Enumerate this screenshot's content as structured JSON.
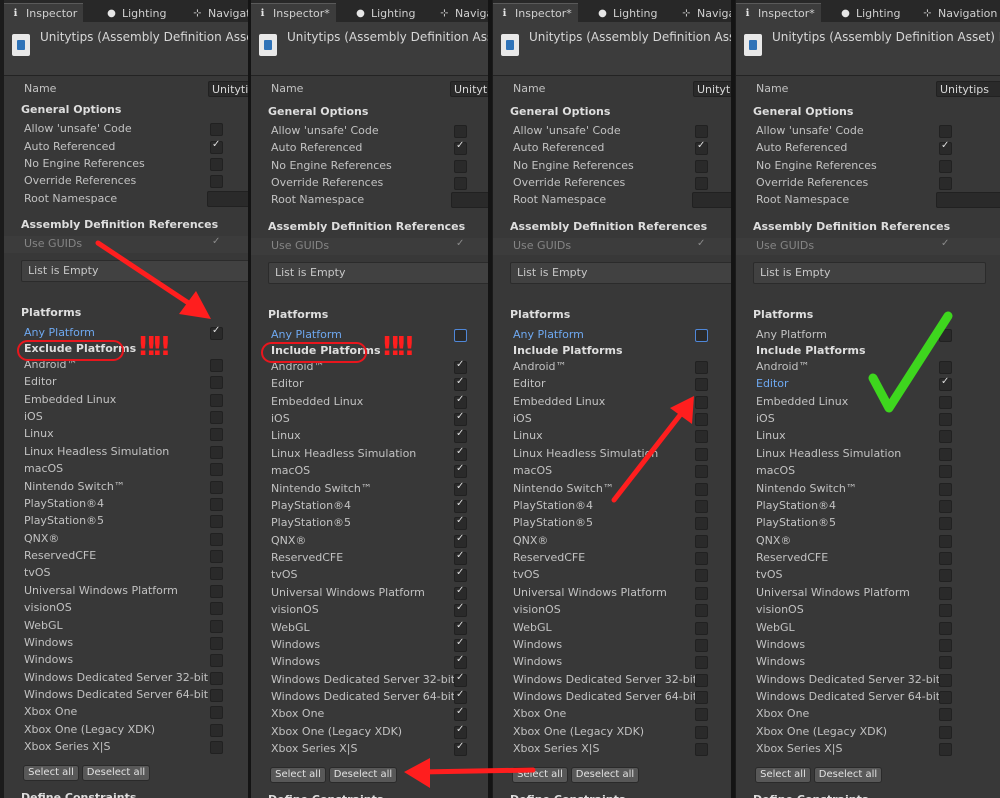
{
  "tabs": {
    "inspector": "Inspector",
    "inspector_modified": "Inspector*",
    "lighting": "Lighting",
    "navigation_cut": "Navigat",
    "navigation_cut2": "Naviga",
    "navigation": "Navigation"
  },
  "headers": [
    "Unitytips (Assembly Definition Asset)",
    "Unitytips (Assembly Definition Asset)",
    "Unitytips (Assembly Definition Asset)",
    "Unitytips (Assembly Definition Asset) Impo"
  ],
  "name_label": "Name",
  "name_values": [
    "Unitytip",
    "Unityti",
    "Unityti",
    "Unitytips"
  ],
  "general": {
    "title": "General Options",
    "options": [
      "Allow 'unsafe' Code",
      "Auto Referenced",
      "No Engine References",
      "Override References",
      "Root Namespace"
    ]
  },
  "asm_refs": {
    "title": "Assembly Definition References",
    "use_guids": "Use GUIDs",
    "list_empty": "List is Empty"
  },
  "platforms_title": "Platforms",
  "any_platform": "Any Platform",
  "exclude_platforms": "Exclude Platforms",
  "include_platforms": "Include Platforms",
  "platforms": [
    "Android™",
    "Editor",
    "Embedded Linux",
    "iOS",
    "Linux",
    "Linux Headless Simulation",
    "macOS",
    "Nintendo Switch™",
    "PlayStation®4",
    "PlayStation®5",
    "QNX®",
    "ReservedCFE",
    "tvOS",
    "Universal Windows Platform",
    "visionOS",
    "WebGL",
    "Windows",
    "Windows",
    "Windows Dedicated Server 32-bit",
    "Windows Dedicated Server 64-bit",
    "Xbox One",
    "Xbox One (Legacy XDK)",
    "Xbox Series X|S"
  ],
  "buttons": {
    "select_all": "Select all",
    "deselect_all": "Deselect all"
  },
  "define_cut": "Define Constraints",
  "annotations": {
    "exclaim": "‼‼",
    "check": "✓"
  },
  "colors": {
    "arrow_red": "#ff1e1e",
    "check_green": "#3ed61e",
    "link_blue": "#6ea8f0"
  },
  "panels": [
    {
      "general": [
        false,
        true,
        false,
        false
      ],
      "any_platform": true,
      "mode": "exclude",
      "platforms": "none"
    },
    {
      "general": [
        false,
        true,
        false,
        false
      ],
      "any_platform": false,
      "mode": "include",
      "platforms": "all"
    },
    {
      "general": [
        false,
        true,
        false,
        false
      ],
      "any_platform": false,
      "mode": "include",
      "platforms": "none"
    },
    {
      "general": [
        false,
        true,
        false,
        false
      ],
      "any_platform": false,
      "mode": "include",
      "platforms": "editor"
    }
  ]
}
